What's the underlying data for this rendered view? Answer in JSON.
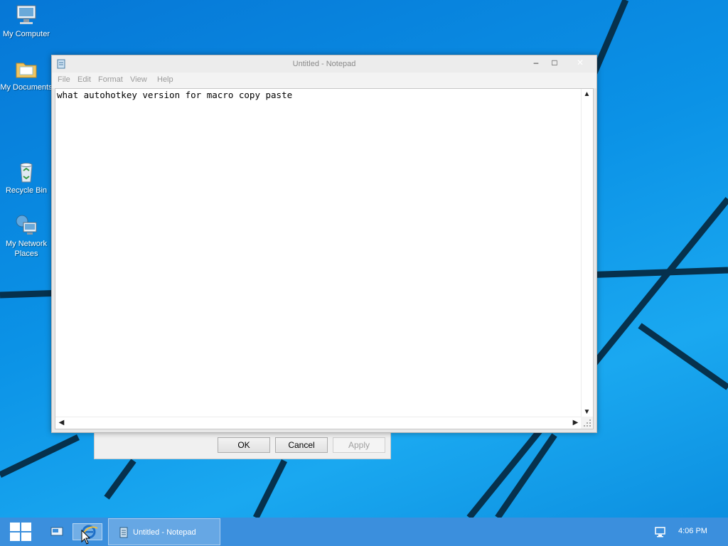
{
  "desktop_icons": [
    {
      "label": "My Computer",
      "icon": "computer-icon"
    },
    {
      "label": "My Documents",
      "icon": "folder-icon"
    },
    {
      "label": "Recycle Bin",
      "icon": "recycle-bin-icon"
    },
    {
      "label": "My Network Places",
      "icon": "network-icon"
    }
  ],
  "notepad": {
    "title": "Untitled - Notepad",
    "menu": [
      "File",
      "Edit",
      "Format",
      "View",
      "Help"
    ],
    "content": "what autohotkey version for macro copy paste",
    "controls": {
      "minimize": "–",
      "maximize": "□",
      "close": "✕"
    }
  },
  "dialog": {
    "ok_label": "OK",
    "cancel_label": "Cancel",
    "apply_label": "Apply"
  },
  "taskbar": {
    "task_label": "Untitled - Notepad",
    "clock": "4:06 PM"
  },
  "colors": {
    "desktop_blue": "#0a8ee0",
    "taskbar_blue": "#3b8fdd",
    "wallpaper_lines": "#06314d"
  }
}
